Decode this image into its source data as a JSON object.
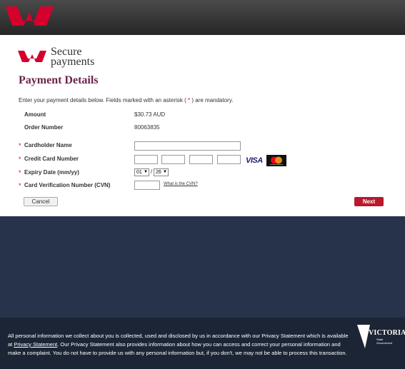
{
  "header": {
    "logo": "westpac-logo"
  },
  "brand": {
    "line1": "Secure",
    "line2": "payments"
  },
  "page_title": "Payment Details",
  "intro": {
    "before": "Enter your payment details below. Fields marked with an asterisk (",
    "star": "*",
    "after": ") are mandatory."
  },
  "summary": {
    "amount_label": "Amount",
    "amount_value": "$30.73 AUD",
    "order_label": "Order Number",
    "order_value": "80063835"
  },
  "form": {
    "cardholder_label": "Cardholder Name",
    "cardholder_value": "",
    "card_number_label": "Credit Card Number",
    "card_number_parts": [
      "",
      "",
      "",
      ""
    ],
    "expiry_label": "Expiry Date (mm/yy)",
    "expiry_month": "01",
    "expiry_year": "26",
    "expiry_separator": "/",
    "cvn_label": "Card Verification Number (CVN)",
    "cvn_value": "",
    "cvn_help_link": "What is the CVN?",
    "required_mark": "*"
  },
  "card_logos": {
    "visa": "VISA",
    "mastercard": "mastercard-logo"
  },
  "buttons": {
    "cancel": "Cancel",
    "next": "Next"
  },
  "footer": {
    "text_1": "All personal information we collect about you is collected, used and disclosed by us in accordance with our Privacy Statement which is available at ",
    "privacy_link": "Privacy Statement",
    "text_2": ". Our Privacy Statement also provides information about how you can access and correct your personal information and make a complaint. You do not have to provide us with any personal information but, if you don't, we may not be able to process this transaction.",
    "vic_name": "VICTORIA",
    "vic_sub": "State Government"
  },
  "colors": {
    "accent": "#6b2449",
    "brand_red": "#d5002b",
    "next_button": "#b8192c",
    "band": "#26334a",
    "footer": "#1c2535"
  }
}
